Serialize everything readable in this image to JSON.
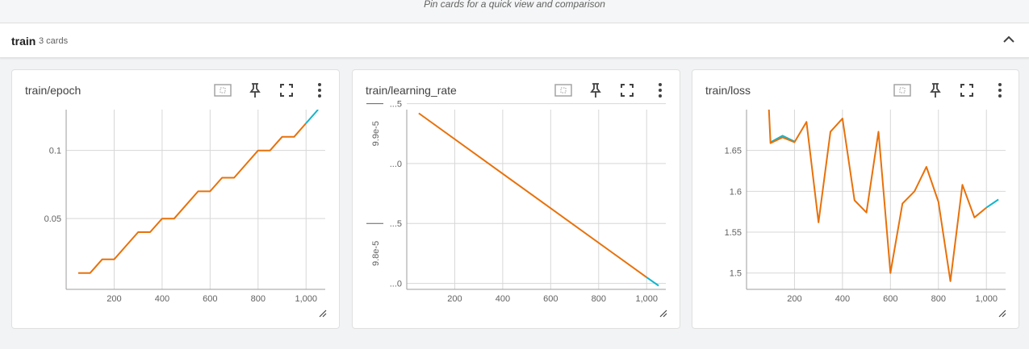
{
  "pin_hint": "Pin cards for a quick view and comparison",
  "group": {
    "title": "train",
    "count": "3 cards"
  },
  "icons": {
    "collapse": "chevron-up-icon",
    "fit": "fit-domain-icon",
    "pin": "pin-icon",
    "fullscreen": "fullscreen-icon",
    "more": "more-vert-icon",
    "resize": "resize-handle-icon"
  },
  "colors": {
    "run_a": "#e8710a",
    "run_b": "#12b5cb",
    "grid": "#d7d7d7"
  },
  "cards": [
    {
      "title": "train/epoch"
    },
    {
      "title": "train/learning_rate"
    },
    {
      "title": "train/loss"
    }
  ],
  "chart_data": [
    {
      "type": "line",
      "title": "train/epoch",
      "xlabel": "",
      "ylabel": "",
      "xlim": [
        0,
        1080
      ],
      "ylim": [
        -0.002,
        0.13
      ],
      "x_ticks": [
        200,
        400,
        600,
        800,
        1000
      ],
      "x_tick_labels": [
        "200",
        "400",
        "600",
        "800",
        "1,000"
      ],
      "y_ticks": [
        0.05,
        0.1
      ],
      "y_tick_labels": [
        "0.05",
        "0.1"
      ],
      "grid": true,
      "series": [
        {
          "color": "#e8710a",
          "x": [
            50,
            100,
            150,
            200,
            250,
            300,
            350,
            400,
            450,
            500,
            550,
            600,
            650,
            700,
            750,
            800,
            850,
            900,
            950,
            1000
          ],
          "y": [
            0.01,
            0.01,
            0.02,
            0.02,
            0.03,
            0.04,
            0.04,
            0.05,
            0.05,
            0.06,
            0.07,
            0.07,
            0.08,
            0.08,
            0.09,
            0.1,
            0.1,
            0.11,
            0.11,
            0.12
          ]
        },
        {
          "color": "#12b5cb",
          "x": [
            1000,
            1050
          ],
          "y": [
            0.12,
            0.13
          ]
        }
      ]
    },
    {
      "type": "line",
      "title": "train/learning_rate",
      "xlabel": "",
      "ylabel": "",
      "xlim": [
        0,
        1080
      ],
      "ylim": [
        9.795e-05,
        9.945e-05
      ],
      "x_ticks": [
        200,
        400,
        600,
        800,
        1000
      ],
      "x_tick_labels": [
        "200",
        "400",
        "600",
        "800",
        "1,000"
      ],
      "y_ticks": [
        9.8e-05,
        9.85e-05,
        9.9e-05,
        9.95e-05
      ],
      "y_tick_labels": [
        "...0",
        "...5",
        "...0",
        "...5"
      ],
      "y_group_labels": [
        "9.8e-5",
        "9.9e-5"
      ],
      "grid": true,
      "series": [
        {
          "color": "#e8710a",
          "x": [
            50,
            1000
          ],
          "y": [
            9.942e-05,
            9.805e-05
          ]
        },
        {
          "color": "#12b5cb",
          "x": [
            1000,
            1050
          ],
          "y": [
            9.805e-05,
            9.798e-05
          ]
        }
      ]
    },
    {
      "type": "line",
      "title": "train/loss",
      "xlabel": "",
      "ylabel": "",
      "xlim": [
        0,
        1080
      ],
      "ylim": [
        1.48,
        1.7
      ],
      "x_ticks": [
        200,
        400,
        600,
        800,
        1000
      ],
      "x_tick_labels": [
        "200",
        "400",
        "600",
        "800",
        "1,000"
      ],
      "y_ticks": [
        1.5,
        1.55,
        1.6,
        1.65
      ],
      "y_tick_labels": [
        "1.5",
        "1.55",
        "1.6",
        "1.65"
      ],
      "grid": true,
      "series": [
        {
          "color": "#12b5cb",
          "x": [
            100,
            150,
            200
          ],
          "y": [
            1.66,
            1.668,
            1.661
          ]
        },
        {
          "color": "#e8710a",
          "x": [
            90,
            100,
            150,
            200,
            250,
            300,
            350,
            400,
            450,
            500,
            550,
            600,
            650,
            700,
            750,
            800,
            850,
            900,
            950,
            1000
          ],
          "y": [
            1.72,
            1.659,
            1.666,
            1.66,
            1.685,
            1.562,
            1.673,
            1.689,
            1.589,
            1.574,
            1.673,
            1.5,
            1.585,
            1.6,
            1.63,
            1.587,
            1.49,
            1.608,
            1.568,
            1.58
          ]
        },
        {
          "color": "#12b5cb",
          "x": [
            1000,
            1050
          ],
          "y": [
            1.58,
            1.59
          ]
        }
      ]
    }
  ]
}
